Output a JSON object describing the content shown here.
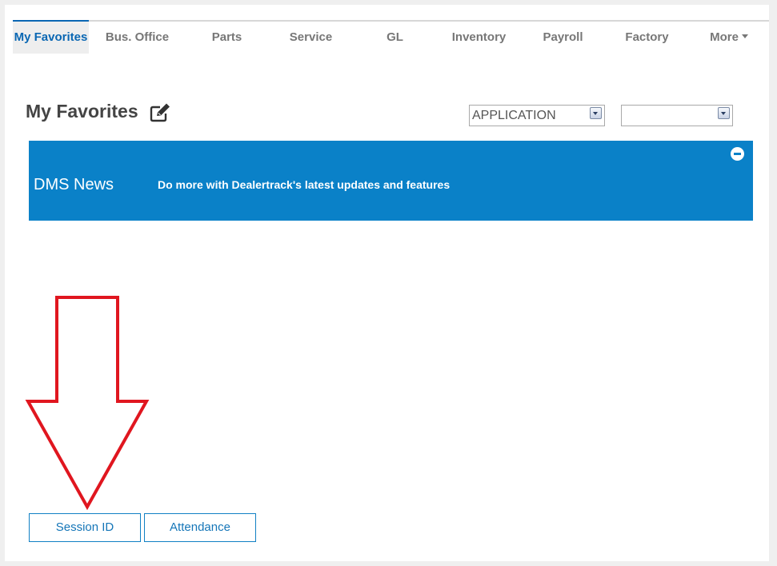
{
  "nav": {
    "tabs": [
      {
        "label": "My Favorites",
        "active": true
      },
      {
        "label": "Bus. Office"
      },
      {
        "label": "Parts"
      },
      {
        "label": "Service"
      },
      {
        "label": "GL"
      },
      {
        "label": "Inventory"
      },
      {
        "label": "Payroll"
      },
      {
        "label": "Factory"
      },
      {
        "label": "More",
        "icon": "caret-down-icon"
      }
    ]
  },
  "page": {
    "title": "My Favorites",
    "edit_icon": "edit-icon"
  },
  "filters": {
    "application": {
      "value": "APPLICATION"
    },
    "secondary": {
      "value": ""
    }
  },
  "news": {
    "title": "DMS News",
    "text": "Do more with Dealertrack's latest updates and features",
    "collapse_icon": "minus-circle-icon"
  },
  "annotation": {
    "icon": "down-arrow-annotation",
    "color": "#e0161f"
  },
  "buttons": [
    {
      "label": "Session ID"
    },
    {
      "label": "Attendance"
    }
  ],
  "colors": {
    "accent": "#0a67b3",
    "banner": "#0a81c8"
  }
}
